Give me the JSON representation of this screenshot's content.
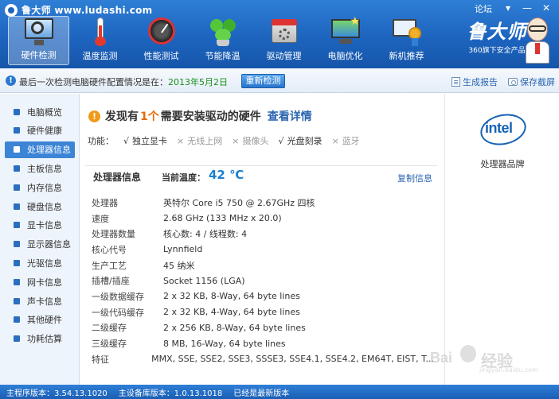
{
  "window": {
    "title": "鲁大师 www.ludashi.com",
    "forum_label": "论坛",
    "controls": [
      "▾",
      "—",
      "✕"
    ]
  },
  "toolbar": {
    "items": [
      {
        "label": "硬件检测",
        "icon": "monitor-magnifier-icon",
        "active": true
      },
      {
        "label": "温度监测",
        "icon": "thermometer-icon",
        "active": false
      },
      {
        "label": "性能测试",
        "icon": "speed-gauge-icon",
        "active": false
      },
      {
        "label": "节能降温",
        "icon": "leaf-plant-icon",
        "active": false
      },
      {
        "label": "驱动管理",
        "icon": "driver-box-icon",
        "active": false
      },
      {
        "label": "电脑优化",
        "icon": "computer-optimize-icon",
        "active": false
      },
      {
        "label": "新机推荐",
        "icon": "award-monitor-icon",
        "active": false
      }
    ]
  },
  "brand": {
    "name": "鲁大师",
    "tagline": "360旗下安全产品"
  },
  "status": {
    "prefix": "最后一次检测电脑硬件配置情况是在：",
    "date": "2013年5月2日",
    "recheck_label": "重新检测",
    "report_label": "生成报告",
    "screenshot_label": "保存截屏"
  },
  "sidebar": {
    "items": [
      {
        "label": "电脑概览",
        "active": false
      },
      {
        "label": "硬件健康",
        "active": false
      },
      {
        "label": "处理器信息",
        "active": true
      },
      {
        "label": "主板信息",
        "active": false
      },
      {
        "label": "内存信息",
        "active": false
      },
      {
        "label": "硬盘信息",
        "active": false
      },
      {
        "label": "显卡信息",
        "active": false
      },
      {
        "label": "显示器信息",
        "active": false
      },
      {
        "label": "光驱信息",
        "active": false
      },
      {
        "label": "网卡信息",
        "active": false
      },
      {
        "label": "声卡信息",
        "active": false
      },
      {
        "label": "其他硬件",
        "active": false
      },
      {
        "label": "功耗估算",
        "active": false
      }
    ]
  },
  "main": {
    "warning": {
      "prefix": "发现有",
      "count": "1个",
      "suffix": "需要安装驱动的硬件",
      "details_link": "查看详情"
    },
    "functions": {
      "label": "功能：",
      "items": [
        {
          "mark": "√",
          "label": "独立显卡",
          "enabled": true
        },
        {
          "mark": "×",
          "label": "无线上网",
          "enabled": false
        },
        {
          "mark": "×",
          "label": "摄像头",
          "enabled": false
        },
        {
          "mark": "√",
          "label": "光盘刻录",
          "enabled": true
        },
        {
          "mark": "×",
          "label": "蓝牙",
          "enabled": false
        }
      ]
    },
    "panel": {
      "title": "处理器信息",
      "temp_label": "当前温度：",
      "temp_value": "42 ℃",
      "copy_label": "复制信息",
      "rows": [
        {
          "key": "处理器",
          "value": "英特尔 Core i5 750 @ 2.67GHz 四核"
        },
        {
          "key": "速度",
          "value": "2.68 GHz (133 MHz x 20.0)"
        },
        {
          "key": "处理器数量",
          "value": "核心数: 4 / 线程数: 4"
        },
        {
          "key": "核心代号",
          "value": "Lynnfield"
        },
        {
          "key": "生产工艺",
          "value": "45 纳米"
        },
        {
          "key": "插槽/插座",
          "value": "Socket 1156 (LGA)"
        },
        {
          "key": "一级数据缓存",
          "value": "2 x 32 KB, 8-Way, 64 byte lines"
        },
        {
          "key": "一级代码缓存",
          "value": "2 x 32 KB, 4-Way, 64 byte lines"
        },
        {
          "key": "二级缓存",
          "value": "2 x 256 KB, 8-Way, 64 byte lines"
        },
        {
          "key": "三级缓存",
          "value": "8 MB, 16-Way, 64 byte lines"
        },
        {
          "key": "特征",
          "value": "MMX, SSE, SSE2, SSE3, SSSE3, SSE4.1, SSE4.2, EM64T, EIST, T..."
        }
      ]
    }
  },
  "right_panel": {
    "logo_text": "intel",
    "label": "处理器品牌"
  },
  "footer": {
    "program_version": "主程序版本：3.54.13.1020",
    "db_version": "主设备库版本：1.0.13.1018",
    "latest": "已经是最新版本"
  },
  "watermark": {
    "logo": "Bai",
    "cn": "经验",
    "url": "jingyan.baidu.com"
  },
  "colors": {
    "header_blue": "#1d64bf",
    "accent_orange": "#e36a0a",
    "link_blue": "#2a64b0",
    "temp_blue": "#1b7fcf",
    "date_green": "#1a8f1a"
  }
}
